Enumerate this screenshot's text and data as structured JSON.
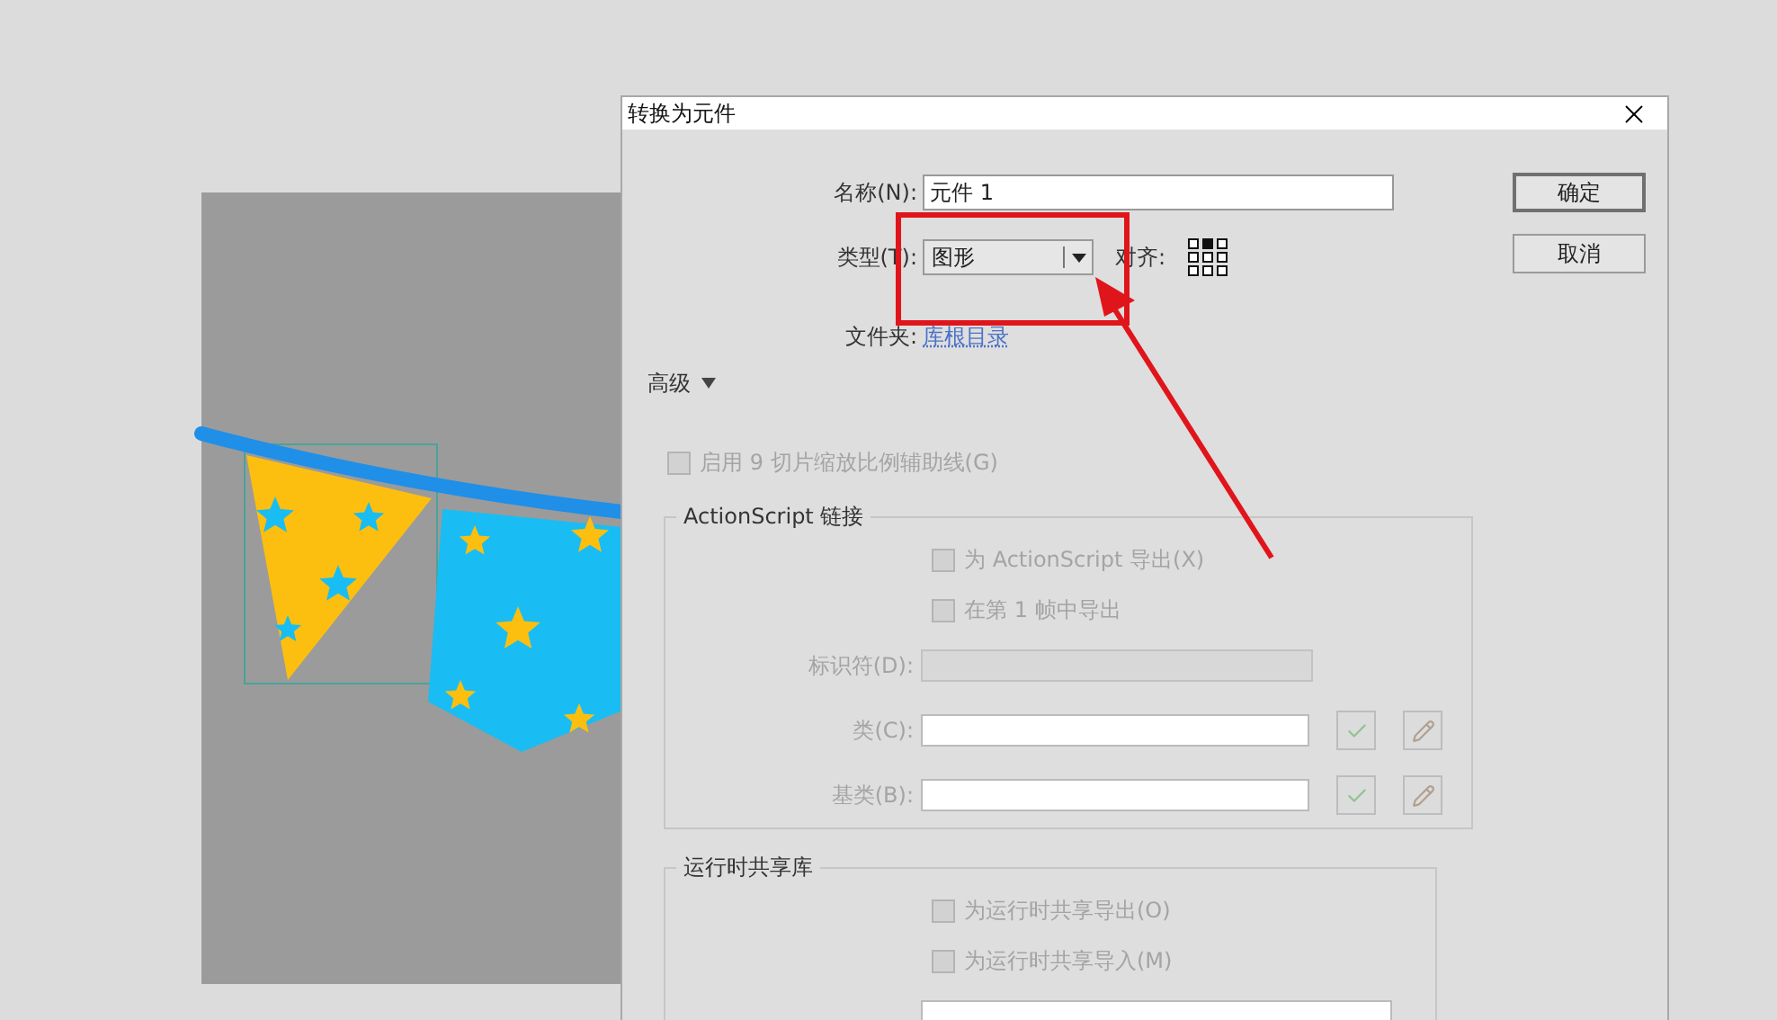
{
  "window": {
    "title": "转换为元件"
  },
  "name_field": {
    "label": "名称(N):",
    "value": "元件 1"
  },
  "type_field": {
    "label": "类型(T):",
    "value": "图形"
  },
  "align": {
    "label": "对齐:"
  },
  "folder": {
    "label": "文件夹:",
    "link": "库根目录"
  },
  "buttons": [
    {
      "label": "确定",
      "default": true
    },
    {
      "label": "取消",
      "default": false
    }
  ],
  "advanced": {
    "label": "高级",
    "expanded": true
  },
  "nine_slice": {
    "label": "启用 9 切片缩放比例辅助线(G)",
    "checked": false,
    "disabled": true
  },
  "actionscript": {
    "title": "ActionScript 链接",
    "checkboxes": [
      {
        "label": "为 ActionScript 导出(X)",
        "checked": false,
        "disabled": true
      },
      {
        "label": "在第 1 帧中导出",
        "checked": false,
        "disabled": true
      }
    ],
    "fields": [
      {
        "kind": "identifier",
        "label": "标识符(D):"
      },
      {
        "kind": "class",
        "label": "类(C):"
      },
      {
        "kind": "class",
        "label": "基类(B):"
      }
    ]
  },
  "runtime": {
    "title": "运行时共享库",
    "checkboxes": [
      {
        "label": "为运行时共享导出(O)",
        "checked": false,
        "disabled": true
      },
      {
        "label": "为运行时共享导入(M)",
        "checked": false,
        "disabled": true
      }
    ],
    "fields": [
      {
        "kind": "url"
      }
    ]
  }
}
